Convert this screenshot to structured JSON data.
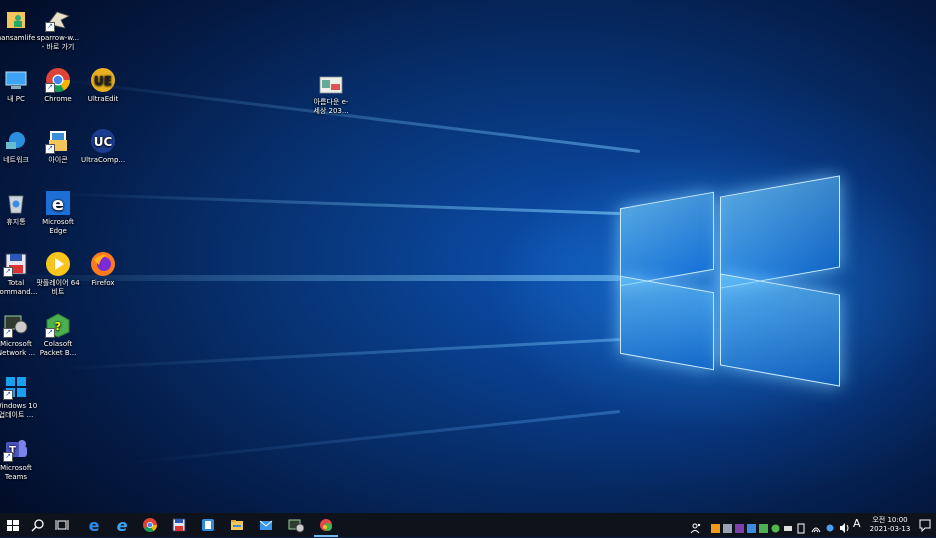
{
  "desktop": {
    "icons": [
      {
        "label": "hansamlife"
      },
      {
        "label": "sparrow-w... - 바로 가기"
      },
      {
        "label": "내 PC"
      },
      {
        "label": "Chrome"
      },
      {
        "label": "UltraEdit"
      },
      {
        "label": "네트워크"
      },
      {
        "label": "아이콘"
      },
      {
        "label": "UltraComp..."
      },
      {
        "label": "휴지통"
      },
      {
        "label": "Microsoft Edge"
      },
      {
        "label": "Total Command..."
      },
      {
        "label": "팟플레이어 64 비트"
      },
      {
        "label": "Firefox"
      },
      {
        "label": "Microsoft Network ..."
      },
      {
        "label": "Colasoft Packet B..."
      },
      {
        "label": "Windows 10 업데이트 ..."
      },
      {
        "label": "Microsoft Teams"
      },
      {
        "label": "아름다운 e-세상 203..."
      }
    ]
  },
  "taskbar": {
    "input_indicator": "A",
    "clock_period_time": "오전 10:00",
    "clock_date": "2021-03-13"
  },
  "colors": {
    "taskbar_bg": "#0d121b",
    "desktop_blue": "#0b4ea8",
    "active_underline": "#76b9ed"
  }
}
